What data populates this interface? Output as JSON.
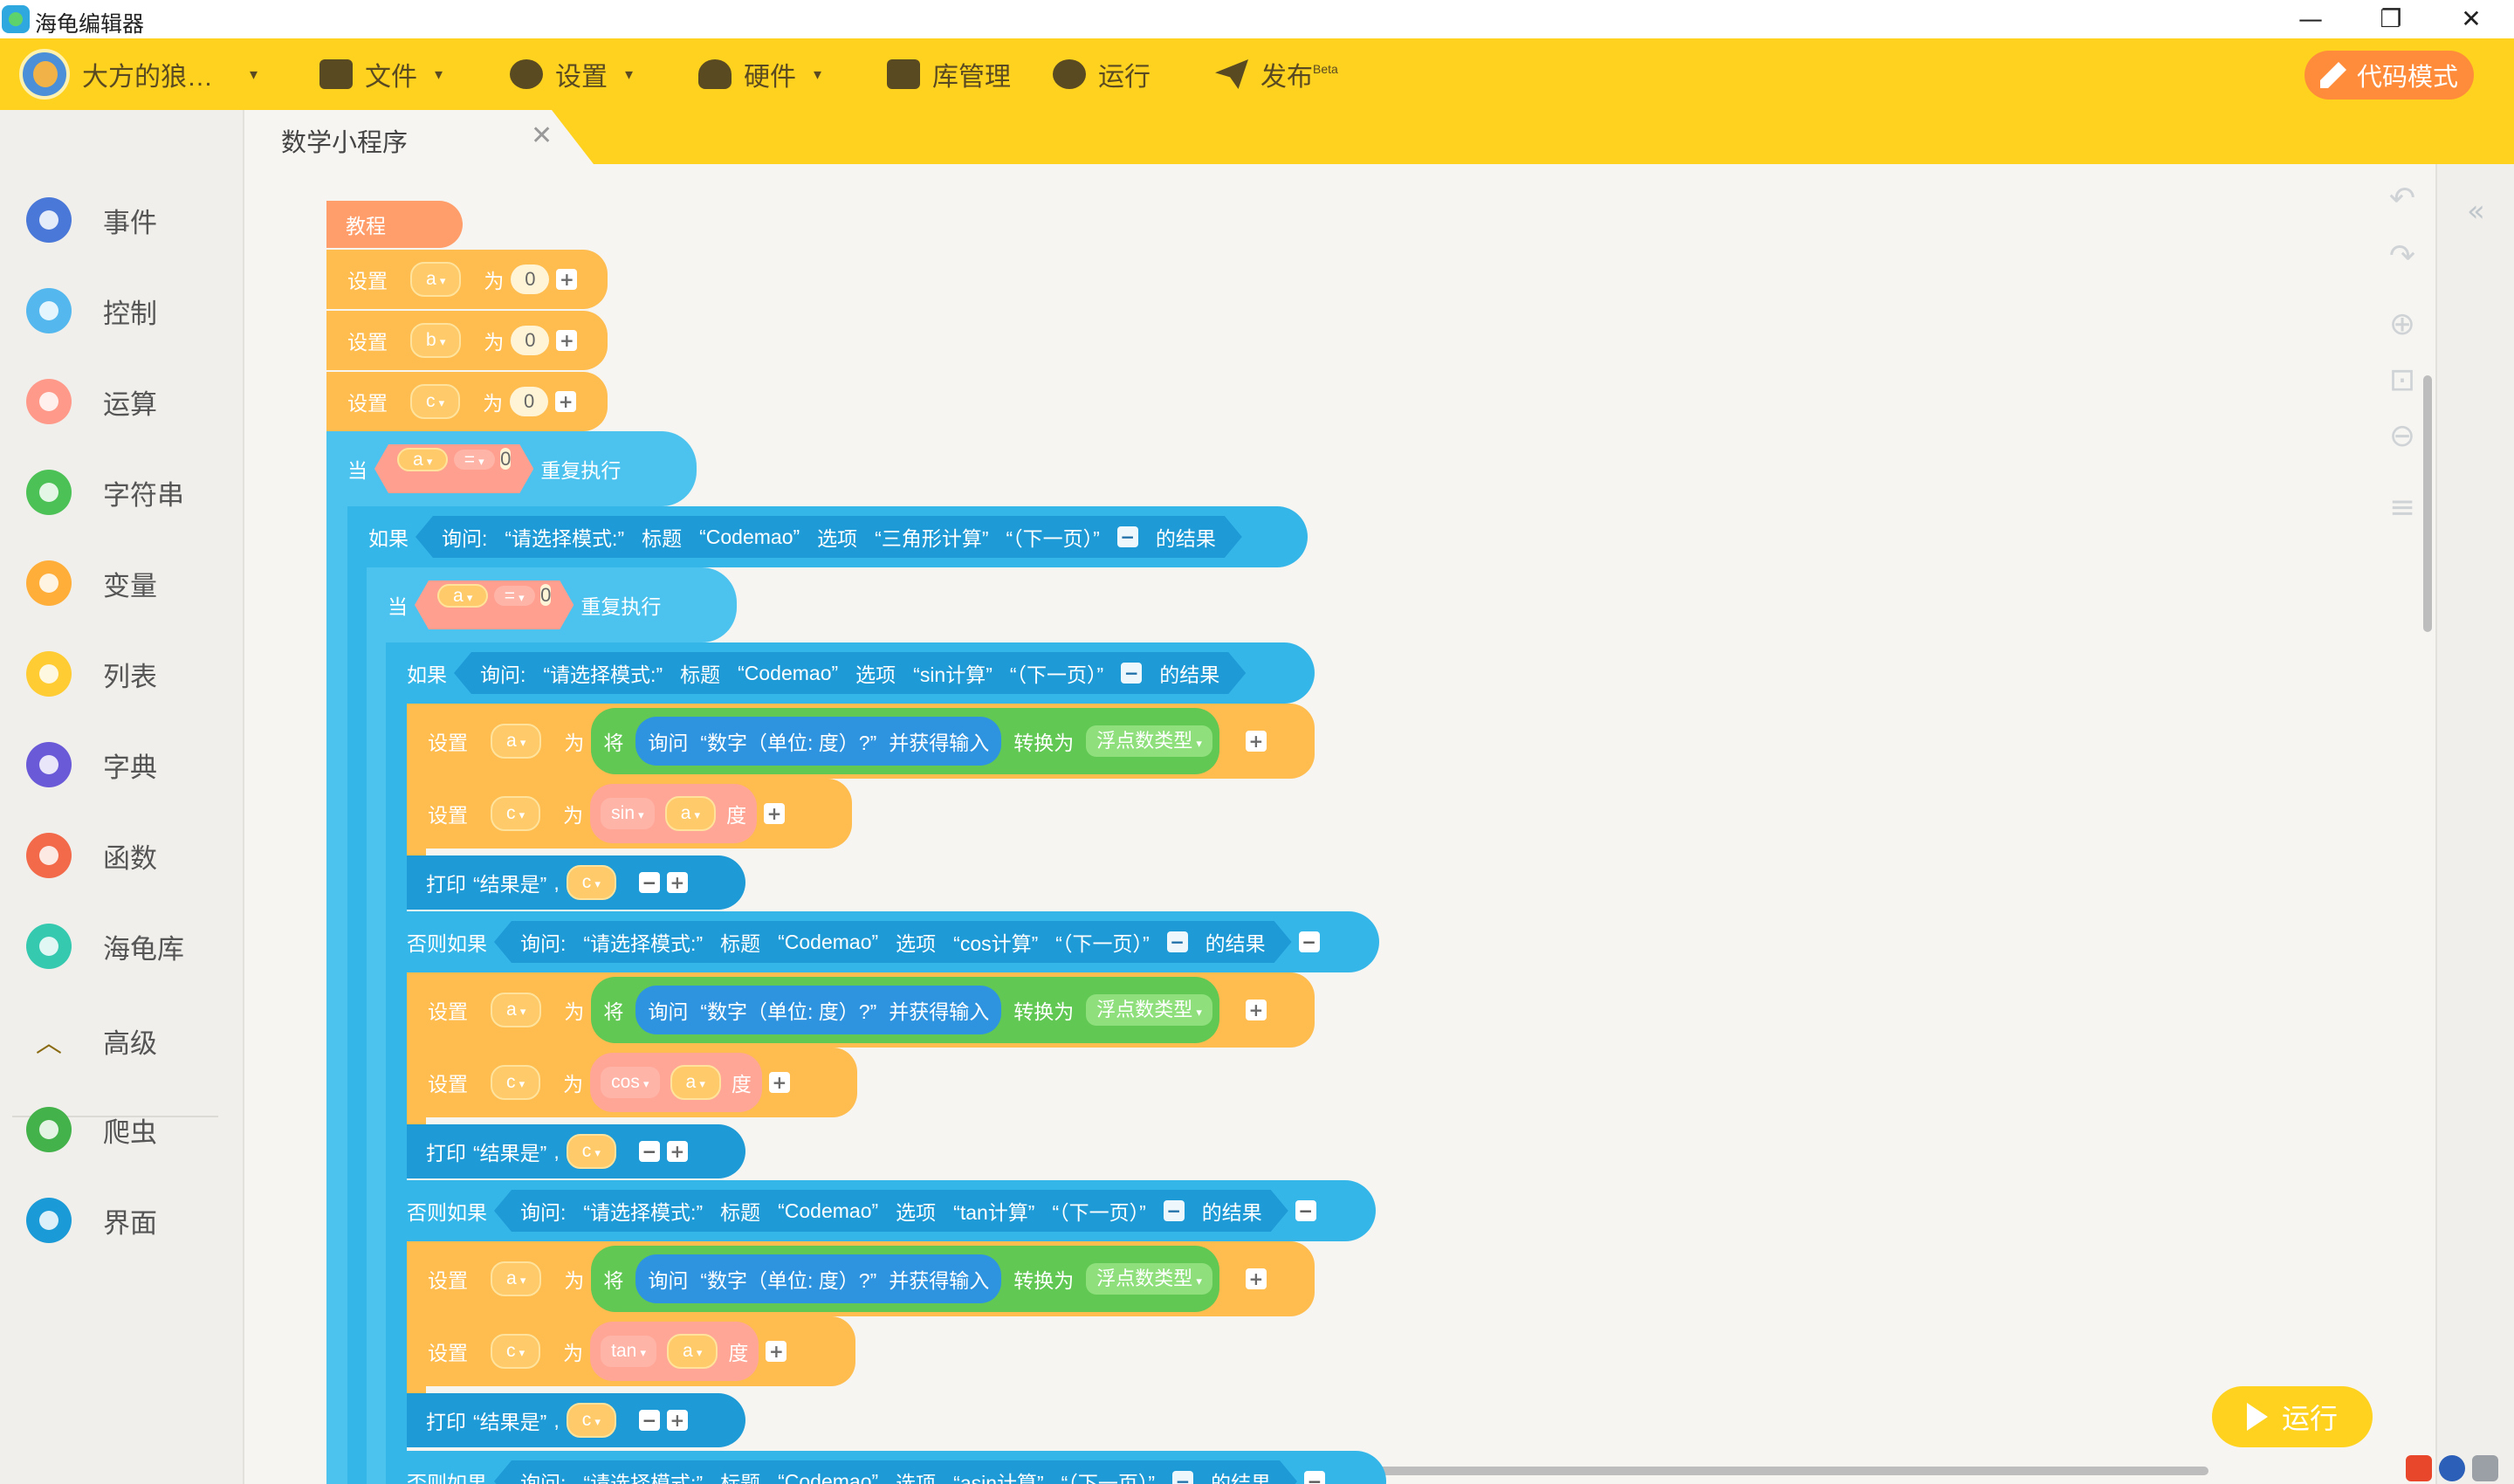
{
  "window": {
    "title": "海龟编辑器",
    "minimize_glyph": "—",
    "maximize_glyph": "❐",
    "close_glyph": "✕"
  },
  "toolbar": {
    "user_name": "大方的狼…",
    "file": "文件",
    "settings": "设置",
    "hardware": "硬件",
    "library": "库管理",
    "run": "运行",
    "publish": "发布",
    "publish_badge": "Beta",
    "code_mode": "代码模式",
    "caret": "▾"
  },
  "tab": {
    "label": "数学小程序",
    "close": "✕"
  },
  "sidebar": {
    "items": [
      {
        "label": "事件",
        "color": "#4a78d8"
      },
      {
        "label": "控制",
        "color": "#54b8ee"
      },
      {
        "label": "运算",
        "color": "#ff9a8a"
      },
      {
        "label": "字符串",
        "color": "#4cc256"
      },
      {
        "label": "变量",
        "color": "#ffae3a"
      },
      {
        "label": "列表",
        "color": "#ffcc33"
      },
      {
        "label": "字典",
        "color": "#6a5ad8"
      },
      {
        "label": "函数",
        "color": "#f26a4a"
      },
      {
        "label": "海龟库",
        "color": "#35c9b0"
      }
    ],
    "advanced": "高级",
    "advanced_glyph": "︿",
    "extra": [
      {
        "label": "爬虫",
        "color": "#43b24a"
      },
      {
        "label": "界面",
        "color": "#1a9ad6"
      }
    ]
  },
  "canvas_tools": {
    "undo": "↶",
    "redo": "↷",
    "zoom_in": "⊕",
    "reset": "⊡",
    "zoom_out": "⊖",
    "tidy": "≡",
    "collapse": "«"
  },
  "blocks": {
    "hat": "教程",
    "set": "设置",
    "as": "为",
    "var_a": "a",
    "var_b": "b",
    "var_c": "c",
    "zero": "0",
    "while": "当",
    "eq": "=",
    "repeat": "重复执行",
    "if": "如果",
    "elif": "否则如果",
    "ask": "询问:",
    "q_mode": "“请选择模式:”",
    "title_word": "标题",
    "codemao": "“Codemao”",
    "options": "选项",
    "opt_tri": "“三角形计算”",
    "opt_sin": "“sin计算”",
    "opt_cos": "“cos计算”",
    "opt_tan": "“tan计算”",
    "opt_asin": "“asin计算”",
    "next_page": "“（下一页）”",
    "result_of": "的结果",
    "convert": "将",
    "ask2": "询问",
    "q_num": "“数字（单位: 度）?”",
    "and_get": "并获得输入",
    "convert_to": "转换为",
    "float_type": "浮点数类型",
    "sin": "sin",
    "cos": "cos",
    "tan": "tan",
    "degree": "度",
    "print": "打印",
    "result_is": "“结果是”",
    "comma": ",",
    "plus": "+",
    "minus": "−"
  },
  "float_run": "运行"
}
